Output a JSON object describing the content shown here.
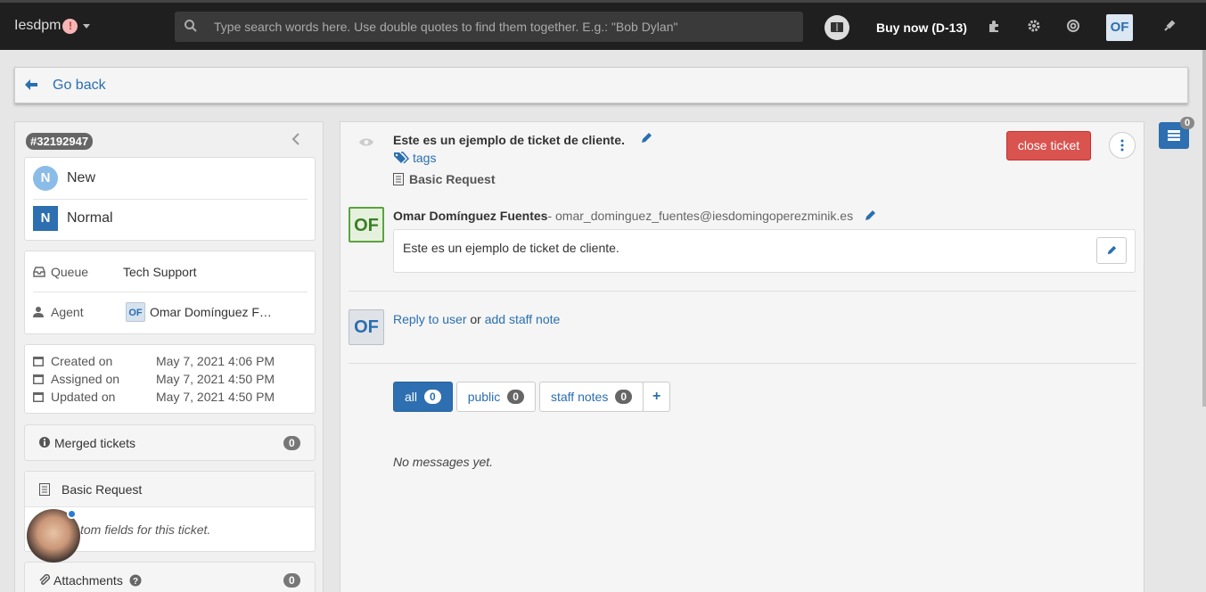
{
  "topbar": {
    "brand": "Iesdpm",
    "alert": "!",
    "search_placeholder": "Type search words here. Use double quotes to find them together. E.g.: \"Bob Dylan\"",
    "buy_now": "Buy now (D-13)",
    "user_initials": "OF"
  },
  "goback": {
    "label": "Go back"
  },
  "ticket": {
    "id": "#32192947",
    "status": {
      "letter": "N",
      "label": "New",
      "color": "#8bbce8"
    },
    "priority": {
      "letter": "N",
      "label": "Normal",
      "color": "#2d6fb0"
    },
    "queue_label": "Queue",
    "queue_value": "Tech Support",
    "agent_label": "Agent",
    "agent_initials": "OF",
    "agent_name": "Omar Domínguez F…",
    "created_label": "Created on",
    "created_value": "May 7, 2021 4:06 PM",
    "assigned_label": "Assigned on",
    "assigned_value": "May 7, 2021 4:50 PM",
    "updated_label": "Updated on",
    "updated_value": "May 7, 2021 4:50 PM",
    "merged_label": "Merged tickets",
    "merged_count": "0",
    "request_type": "Basic Request",
    "custom_fields_text": "tom fields for this ticket.",
    "attachments_label": "Attachments",
    "attachments_count": "0"
  },
  "main": {
    "subject": "Este es un ejemplo de ticket de cliente.",
    "tags_label": "tags",
    "request_type": "Basic Request",
    "close_label": "close ticket",
    "author_initials": "OF",
    "author_name": "Omar Domínguez Fuentes",
    "author_email": " - omar_dominguez_fuentes@iesdomingoperezminik.es",
    "message": "Este es un ejemplo de ticket de cliente.",
    "reply_initials": "OF",
    "reply_link": "Reply to user",
    "reply_or": " or ",
    "staff_note_link": "add staff note",
    "tabs": [
      {
        "label": "all",
        "count": "0"
      },
      {
        "label": "public",
        "count": "0"
      },
      {
        "label": "staff notes",
        "count": "0"
      }
    ],
    "add_tab": "+",
    "no_messages": "No messages yet."
  },
  "right_widget": {
    "count": "0"
  }
}
